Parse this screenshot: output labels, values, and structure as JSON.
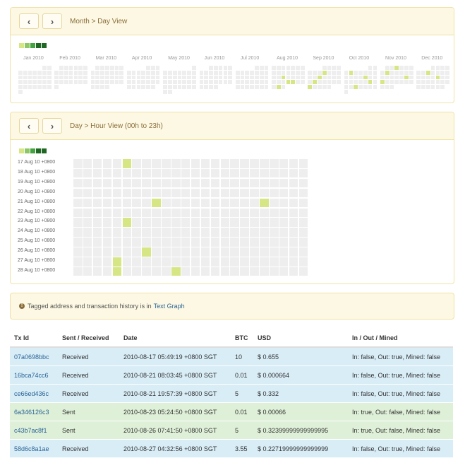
{
  "month_panel": {
    "title": "Month > Day View",
    "prev": "‹",
    "next": "›",
    "months": [
      "Jan 2010",
      "Feb 2010",
      "Mar 2010",
      "Apr 2010",
      "May 2010",
      "Jun 2010",
      "Jul 2010",
      "Aug 2010",
      "Sep 2010",
      "Oct 2010",
      "Nov 2010",
      "Dec 2010"
    ]
  },
  "hour_panel": {
    "title": "Day > Hour View (00h to 23h)",
    "prev": "‹",
    "next": "›",
    "days": [
      "17 Aug 10 +0800",
      "18 Aug 10 +0800",
      "19 Aug 10 +0800",
      "20 Aug 10 +0800",
      "21 Aug 10 +0800",
      "22 Aug 10 +0800",
      "23 Aug 10 +0800",
      "24 Aug 10 +0800",
      "25 Aug 10 +0800",
      "26 Aug 10 +0800",
      "27 Aug 10 +0800",
      "28 Aug 10 +0800"
    ]
  },
  "legend_colors": [
    "#d6e685",
    "#8cc665",
    "#44a340",
    "#1e6823",
    "#1e6823"
  ],
  "empty_color": "#eeeeee",
  "active_color": "#d6e685",
  "alert": {
    "icon": "!",
    "text": "Tagged address and transaction history is in",
    "link": "Text Graph"
  },
  "table": {
    "headers": [
      "Tx Id",
      "Sent / Received",
      "Date",
      "BTC",
      "USD",
      "In / Out / Mined"
    ],
    "rows": [
      {
        "kind": "received",
        "txid": "07a0698bbc",
        "dir": "Received",
        "date": "2010-08-17 05:49:19 +0800 SGT",
        "btc": "10",
        "usd": "$ 0.655",
        "flags": "In: false, Out: true, Mined: false"
      },
      {
        "kind": "received",
        "txid": "16bca74cc6",
        "dir": "Received",
        "date": "2010-08-21 08:03:45 +0800 SGT",
        "btc": "0.01",
        "usd": "$ 0.000664",
        "flags": "In: false, Out: true, Mined: false"
      },
      {
        "kind": "received",
        "txid": "ce66ed436c",
        "dir": "Received",
        "date": "2010-08-21 19:57:39 +0800 SGT",
        "btc": "5",
        "usd": "$ 0.332",
        "flags": "In: false, Out: true, Mined: false"
      },
      {
        "kind": "sent",
        "txid": "6a346126c3",
        "dir": "Sent",
        "date": "2010-08-23 05:24:50 +0800 SGT",
        "btc": "0.01",
        "usd": "$ 0.00066",
        "flags": "In: true, Out: false, Mined: false"
      },
      {
        "kind": "sent",
        "txid": "c43b7ac8f1",
        "dir": "Sent",
        "date": "2010-08-26 07:41:50 +0800 SGT",
        "btc": "5",
        "usd": "$ 0.32399999999999995",
        "flags": "In: true, Out: false, Mined: false"
      },
      {
        "kind": "received",
        "txid": "58d6c8a1ae",
        "dir": "Received",
        "date": "2010-08-27 04:32:56 +0800 SGT",
        "btc": "3.55",
        "usd": "$ 0.22719999999999999",
        "flags": "In: false, Out: true, Mined: false"
      }
    ]
  }
}
